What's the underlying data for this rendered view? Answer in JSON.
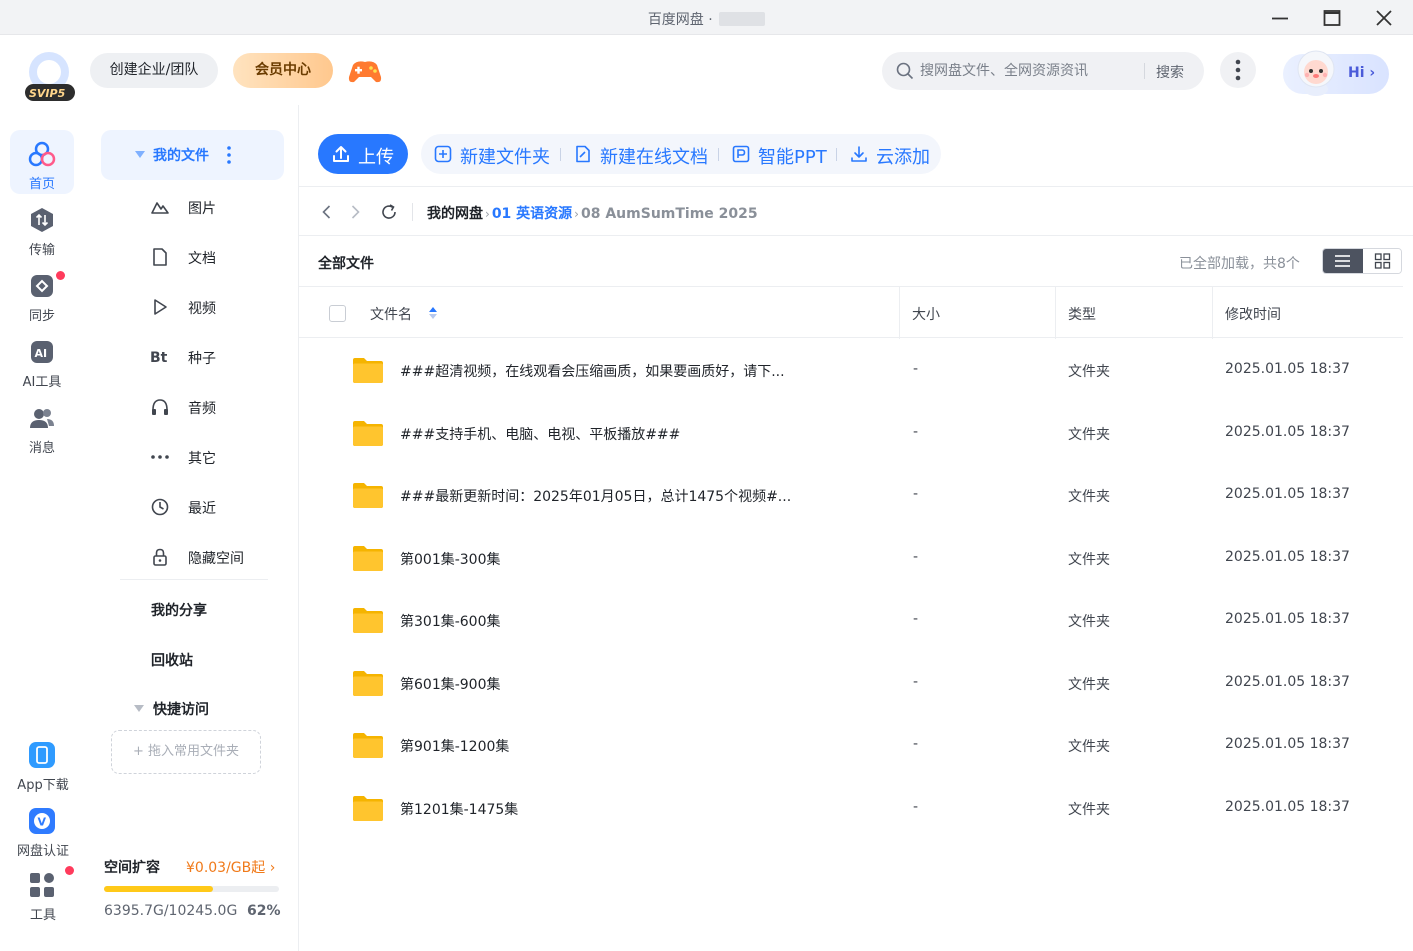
{
  "window": {
    "title": "百度网盘 ·"
  },
  "topbar": {
    "svip_badge": "SVIP5",
    "team_button": "创建企业/团队",
    "vip_button": "会员中心",
    "search_placeholder": "搜网盘文件、全网资源资讯",
    "search_button": "搜索",
    "hi_label": "Hi"
  },
  "rail": {
    "items": [
      {
        "label": "首页",
        "icon": "home-icon"
      },
      {
        "label": "传输",
        "icon": "transfer-icon"
      },
      {
        "label": "同步",
        "icon": "sync-icon"
      },
      {
        "label": "AI工具",
        "icon": "ai-tools-icon"
      },
      {
        "label": "消息",
        "icon": "message-icon"
      }
    ],
    "bottom_items": [
      {
        "label": "App下载",
        "icon": "app-download-icon"
      },
      {
        "label": "网盘认证",
        "icon": "verify-icon"
      },
      {
        "label": "工具",
        "icon": "tools-icon"
      }
    ]
  },
  "sidenav": {
    "my_files": "我的文件",
    "categories": [
      {
        "label": "图片",
        "icon": "image-icon"
      },
      {
        "label": "文档",
        "icon": "document-icon"
      },
      {
        "label": "视频",
        "icon": "video-icon"
      },
      {
        "label": "种子",
        "icon": "torrent-icon"
      },
      {
        "label": "音频",
        "icon": "audio-icon"
      },
      {
        "label": "其它",
        "icon": "more-icon"
      },
      {
        "label": "最近",
        "icon": "recent-icon"
      },
      {
        "label": "隐藏空间",
        "icon": "lock-icon"
      }
    ],
    "my_share": "我的分享",
    "recycle": "回收站",
    "quick_access": "快捷访问",
    "dropzone": "+ 拖入常用文件夹",
    "quota": {
      "title": "空间扩容",
      "price": "¥0.03/GB起",
      "used": "6395.7G/10245.0G",
      "percent_text": "62%",
      "percent": 62
    }
  },
  "toolbar": {
    "upload": "上传",
    "new_folder": "新建文件夹",
    "new_doc": "新建在线文档",
    "ppt": "智能PPT",
    "cloud_add": "云添加"
  },
  "breadcrumb": {
    "root": "我的网盘",
    "mid": "01 英语资源",
    "current": "08 AumSumTime 2025"
  },
  "list": {
    "title": "全部文件",
    "status": "已全部加载，共8个",
    "columns": {
      "name": "文件名",
      "size": "大小",
      "type": "类型",
      "modified": "修改时间"
    },
    "rows": [
      {
        "name": "###超清视频，在线观看会压缩画质，如果要画质好，请下...",
        "size": "-",
        "type": "文件夹",
        "modified": "2025.01.05 18:37"
      },
      {
        "name": "###支持手机、电脑、电视、平板播放###",
        "size": "-",
        "type": "文件夹",
        "modified": "2025.01.05 18:37"
      },
      {
        "name": "###最新更新时间：2025年01月05日，总计1475个视频#...",
        "size": "-",
        "type": "文件夹",
        "modified": "2025.01.05 18:37"
      },
      {
        "name": "第001集-300集",
        "size": "-",
        "type": "文件夹",
        "modified": "2025.01.05 18:37"
      },
      {
        "name": "第301集-600集",
        "size": "-",
        "type": "文件夹",
        "modified": "2025.01.05 18:37"
      },
      {
        "name": "第601集-900集",
        "size": "-",
        "type": "文件夹",
        "modified": "2025.01.05 18:37"
      },
      {
        "name": "第901集-1200集",
        "size": "-",
        "type": "文件夹",
        "modified": "2025.01.05 18:37"
      },
      {
        "name": "第1201集-1475集",
        "size": "-",
        "type": "文件夹",
        "modified": "2025.01.05 18:37"
      }
    ]
  },
  "colors": {
    "accent": "#2878ff",
    "folder": "#ffc52e",
    "quota_fill": "#ffc919",
    "badge_red": "#ff3b5c"
  }
}
